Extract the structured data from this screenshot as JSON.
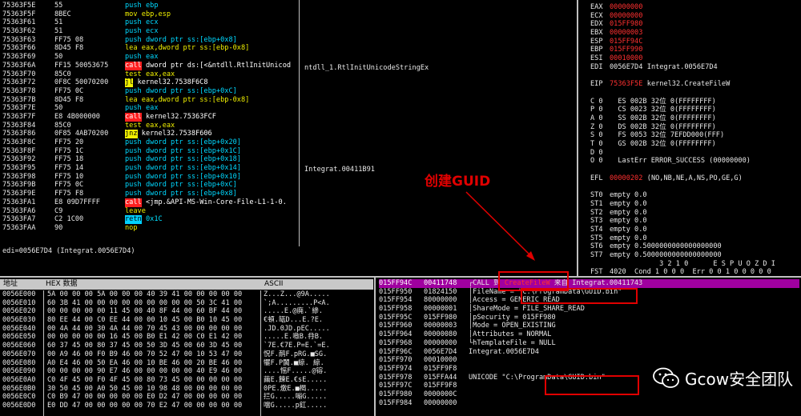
{
  "disasm": [
    {
      "a": "75363F5E",
      "h": "55",
      "p": "push ",
      "o": "ebp",
      "t": "c"
    },
    {
      "a": "75363F5F",
      "h": "8BEC",
      "p": "mov ",
      "o": "ebp,esp",
      "t": "w"
    },
    {
      "a": "75363F61",
      "h": "51",
      "p": "push ",
      "o": "ecx",
      "t": "c"
    },
    {
      "a": "75363F62",
      "h": "51",
      "p": "push ",
      "o": "ecx",
      "t": "c"
    },
    {
      "a": "75363F63",
      "h": "FF75 08",
      "p": "push ",
      "o": "dword ptr ss:[ebp+0x8]",
      "t": "c"
    },
    {
      "a": "75363F66",
      "h": "8D45 F8",
      "p": "lea ",
      "o": "eax,dword ptr ss:[ebp-0x8]",
      "t": "w"
    },
    {
      "a": "75363F69",
      "h": "50",
      "p": "push ",
      "o": "eax",
      "t": "c"
    },
    {
      "a": "75363F6A",
      "h": "FF15 50053675",
      "p": "call",
      "o": " dword ptr ds:[<&ntdll.RtlInitUnicod",
      "t": "call"
    },
    {
      "a": "75363F70",
      "h": "85C0",
      "p": "test ",
      "o": "eax,eax",
      "t": "w"
    },
    {
      "a": "75363F72",
      "h": "0F8C 50070200",
      "p": "jl",
      "o": " kernel32.7538F6C8",
      "t": "jmp"
    },
    {
      "a": "75363F78",
      "h": "FF75 0C",
      "p": "push ",
      "o": "dword ptr ss:[ebp+0xC]",
      "t": "c"
    },
    {
      "a": "75363F7B",
      "h": "8D45 F8",
      "p": "lea ",
      "o": "eax,dword ptr ss:[ebp-0x8]",
      "t": "w"
    },
    {
      "a": "75363F7E",
      "h": "50",
      "p": "push ",
      "o": "eax",
      "t": "c"
    },
    {
      "a": "75363F7F",
      "h": "E8 4B000000",
      "p": "call",
      "o": " kernel32.75363FCF",
      "t": "call"
    },
    {
      "a": "75363F84",
      "h": "85C0",
      "p": "test ",
      "o": "eax,eax",
      "t": "w"
    },
    {
      "a": "75363F86",
      "h": "0F85 4AB70200",
      "p": "jnz",
      "o": " kernel32.7538F606",
      "t": "jmp"
    },
    {
      "a": "75363F8C",
      "h": "FF75 20",
      "p": "push ",
      "o": "dword ptr ss:[ebp+0x20]",
      "t": "c"
    },
    {
      "a": "75363F8F",
      "h": "FF75 1C",
      "p": "push ",
      "o": "dword ptr ss:[ebp+0x1C]",
      "t": "c"
    },
    {
      "a": "75363F92",
      "h": "FF75 18",
      "p": "push ",
      "o": "dword ptr ss:[ebp+0x18]",
      "t": "c"
    },
    {
      "a": "75363F95",
      "h": "FF75 14",
      "p": "push ",
      "o": "dword ptr ss:[ebp+0x14]",
      "t": "c"
    },
    {
      "a": "75363F98",
      "h": "FF75 10",
      "p": "push ",
      "o": "dword ptr ss:[ebp+0x10]",
      "t": "c"
    },
    {
      "a": "75363F9B",
      "h": "FF75 0C",
      "p": "push ",
      "o": "dword ptr ss:[ebp+0xC]",
      "t": "c"
    },
    {
      "a": "75363F9E",
      "h": "FF75 F8",
      "p": "push ",
      "o": "dword ptr ss:[ebp+0x8]",
      "t": "c"
    },
    {
      "a": "75363FA1",
      "h": "E8 09D7FFFF",
      "p": "call",
      "o": " <jmp.&API-MS-Win-Core-File-L1-1-0.",
      "t": "call"
    },
    {
      "a": "75363FA6",
      "h": "C9",
      "p": "leave",
      "o": "",
      "t": "w"
    },
    {
      "a": "75363FA7",
      "h": "C2 1C00",
      "p": "retn",
      "o": " 0x1C",
      "t": "retn"
    },
    {
      "a": "75363FAA",
      "h": "90",
      "p": "nop",
      "o": "",
      "t": "w"
    }
  ],
  "comments": {
    "c7": "ntdll_1.RtlInitUnicodeStringEx",
    "c19": "Integrat.00411B91"
  },
  "info_line": "edi=0056E7D4 (Integrat.0056E7D4)",
  "registers": [
    {
      "n": "EAX",
      "v": "00000000",
      "col": "r",
      "x": ""
    },
    {
      "n": "ECX",
      "v": "00000000",
      "col": "r",
      "x": ""
    },
    {
      "n": "EDX",
      "v": "015FF980",
      "col": "r",
      "x": ""
    },
    {
      "n": "EBX",
      "v": "00000003",
      "col": "r",
      "x": ""
    },
    {
      "n": "ESP",
      "v": "015FF94C",
      "col": "r",
      "x": ""
    },
    {
      "n": "EBP",
      "v": "015FF990",
      "col": "r",
      "x": ""
    },
    {
      "n": "ESI",
      "v": "00010000",
      "col": "r",
      "x": ""
    },
    {
      "n": "EDI",
      "v": "0056E7D4",
      "col": "w",
      "x": " Integrat.0056E7D4"
    },
    {
      "n": "",
      "v": "",
      "col": "w",
      "x": ""
    },
    {
      "n": "EIP",
      "v": "75363F5E",
      "col": "r",
      "x": " kernel32.CreateFileW"
    },
    {
      "n": "",
      "v": "",
      "col": "w",
      "x": ""
    },
    {
      "n": "C 0",
      "v": "  ES 002B 32位 0(FFFFFFFF)",
      "col": "w",
      "x": ""
    },
    {
      "n": "P 0",
      "v": "  CS 0023 32位 0(FFFFFFFF)",
      "col": "w",
      "x": ""
    },
    {
      "n": "A 0",
      "v": "  SS 002B 32位 0(FFFFFFFF)",
      "col": "w",
      "x": ""
    },
    {
      "n": "Z 0",
      "v": "  DS 002B 32位 0(FFFFFFFF)",
      "col": "w",
      "x": ""
    },
    {
      "n": "S 0",
      "v": "  FS 0053 32位 7EFDD000(FFF)",
      "col": "w",
      "x": ""
    },
    {
      "n": "T 0",
      "v": "  GS 002B 32位 0(FFFFFFFF)",
      "col": "w",
      "x": ""
    },
    {
      "n": "D 0",
      "v": "",
      "col": "w",
      "x": ""
    },
    {
      "n": "O 0",
      "v": "  LastErr ERROR_SUCCESS (00000000)",
      "col": "w",
      "x": ""
    },
    {
      "n": "",
      "v": "",
      "col": "w",
      "x": ""
    },
    {
      "n": "EFL",
      "v": "00000202",
      "col": "r",
      "x": " (NO,NB,NE,A,NS,PO,GE,G)"
    },
    {
      "n": "",
      "v": "",
      "col": "w",
      "x": ""
    },
    {
      "n": "ST0",
      "v": "empty 0.0",
      "col": "w",
      "x": ""
    },
    {
      "n": "ST1",
      "v": "empty 0.0",
      "col": "w",
      "x": ""
    },
    {
      "n": "ST2",
      "v": "empty 0.0",
      "col": "w",
      "x": ""
    },
    {
      "n": "ST3",
      "v": "empty 0.0",
      "col": "w",
      "x": ""
    },
    {
      "n": "ST4",
      "v": "empty 0.0",
      "col": "w",
      "x": ""
    },
    {
      "n": "ST5",
      "v": "empty 0.0",
      "col": "w",
      "x": ""
    },
    {
      "n": "ST6",
      "v": "empty 0.5000000000000000000",
      "col": "w",
      "x": ""
    },
    {
      "n": "ST7",
      "v": "empty 0.5000000000000000000",
      "col": "w",
      "x": ""
    },
    {
      "n": "",
      "v": "            3 2 1 0      E S P U O Z D I",
      "col": "w",
      "x": ""
    },
    {
      "n": "FST",
      "v": "4020  Cond 1 0 0 0  Err 0 0 1 0 0 0 0 0",
      "col": "w",
      "x": ""
    }
  ],
  "dump_header": {
    "addr": "地址",
    "hex": "HEX 数据",
    "ascii": "ASCII"
  },
  "dump": [
    {
      "a": "0056E000",
      "h": "5A 00 00 00 5A 00 00 00 40 39 41 00 00 00 00 00",
      "s": "Z...Z...@9A....."
    },
    {
      "a": "0056E010",
      "h": "60 3B 41 00 00 00 00 00 00 00 00 00 50 3C 41 00",
      "s": "`;A.........P<A."
    },
    {
      "a": "0056E020",
      "h": "00 00 00 00 00 11 45 00 40 8F 44 00 60 BF 44 00",
      "s": ".....E.@廃.`縿."
    },
    {
      "a": "0056E030",
      "h": "80 EE 44 00 C0 EE 44 00 00 10 45 00 B0 10 45 00",
      "s": "€頓.缻D...E.?E."
    },
    {
      "a": "0056E040",
      "h": "00 4A 44 00 30 4A 44 00 70 45 43 00 00 00 00 00",
      "s": ".JD.0JD.pEC....."
    },
    {
      "a": "0056E050",
      "h": "00 00 00 00 00 16 45 00 B0 E1 42 00 C0 E1 42 00",
      "s": ".....E.嗷B.冄B."
    },
    {
      "a": "0056E060",
      "h": "60 37 45 00 80 37 45 00 50 3D 45 00 60 3D 45 00",
      "s": "`7E.€7E.P=E.`=E."
    },
    {
      "a": "0056E070",
      "h": "00 A9 46 00 F0 B9 46 00 70 52 47 00 10 53 47 00",
      "s": "怳F.鸸F.pRG.■SG."
    },
    {
      "a": "0056E080",
      "h": "A0 E4 46 00 50 EA 46 00 10 BE 46 00 20 BE 46 00",
      "s": "犤F.P闐.■綡. 綡."
    },
    {
      "a": "0056E090",
      "h": "00 00 00 00 90 E7 46 00 00 00 00 00 40 E9 46 00",
      "s": "....愮F.....@镕."
    },
    {
      "a": "0056E0A0",
      "h": "C0 4F 45 00 F0 4F 45 00 80 73 45 00 00 00 00 00",
      "s": "繭E.餗E.€sE....."
    },
    {
      "a": "0056E0B0",
      "h": "30 50 45 00 A0 50 45 00 10 98 48 00 00 00 00 00",
      "s": "0PE.燩E.■楬....."
    },
    {
      "a": "0056E0C0",
      "h": "C0 B9 47 00 00 00 00 00 E0 D2 47 00 00 00 00 00",
      "s": "拦G.....嘣G....."
    },
    {
      "a": "0056E0D0",
      "h": "E0 DD 47 00 00 00 00 00 70 E2 47 00 00 00 00 00",
      "s": "噹G.....p釭....."
    }
  ],
  "stack": [
    {
      "a": "015FF94C",
      "v": "00411748",
      "c": "┌CALL 到 ",
      "c2": "CreateFileW",
      "c3": " 来自 Integrat.00411743"
    },
    {
      "a": "015FF950",
      "v": "01824150",
      "c": "│FileName = ",
      "c2": "\"C:\\ProgramData\\GUID.bin\"",
      "c3": ""
    },
    {
      "a": "015FF954",
      "v": "80000000",
      "c": "│Access = GENERIC_READ",
      "c2": "",
      "c3": ""
    },
    {
      "a": "015FF958",
      "v": "00000001",
      "c": "│ShareMode = FILE_SHARE_READ",
      "c2": "",
      "c3": ""
    },
    {
      "a": "015FF95C",
      "v": "015FF980",
      "c": "│pSecurity = 015FF980",
      "c2": "",
      "c3": ""
    },
    {
      "a": "015FF960",
      "v": "00000003",
      "c": "│Mode = OPEN_EXISTING",
      "c2": "",
      "c3": ""
    },
    {
      "a": "015FF964",
      "v": "00000080",
      "c": "│Attributes = NORMAL",
      "c2": "",
      "c3": ""
    },
    {
      "a": "015FF968",
      "v": "00000000",
      "c": "└hTemplateFile = NULL",
      "c2": "",
      "c3": ""
    },
    {
      "a": "015FF96C",
      "v": "0056E7D4",
      "c": "Integrat.0056E7D4",
      "c2": "",
      "c3": ""
    },
    {
      "a": "015FF970",
      "v": "00010000",
      "c": "",
      "c2": "",
      "c3": ""
    },
    {
      "a": "015FF974",
      "v": "015FF9F8",
      "c": "",
      "c2": "",
      "c3": ""
    },
    {
      "a": "015FF978",
      "v": "015FFA44",
      "c": "UNICODE \"C:\\ProgramData\\GUID.bin\"",
      "c2": "",
      "c3": ""
    },
    {
      "a": "015FF97C",
      "v": "015FF9F8",
      "c": "",
      "c2": "",
      "c3": ""
    },
    {
      "a": "015FF980",
      "v": "0000000C",
      "c": "",
      "c2": "",
      "c3": ""
    },
    {
      "a": "015FF984",
      "v": "00000000",
      "c": "",
      "c2": "",
      "c3": ""
    }
  ],
  "annotation": "创建GUID",
  "watermark": "Gcow安全团队",
  "colors": {
    "accent_red": "#ff2020",
    "stack_highlight": "#a000a0"
  }
}
